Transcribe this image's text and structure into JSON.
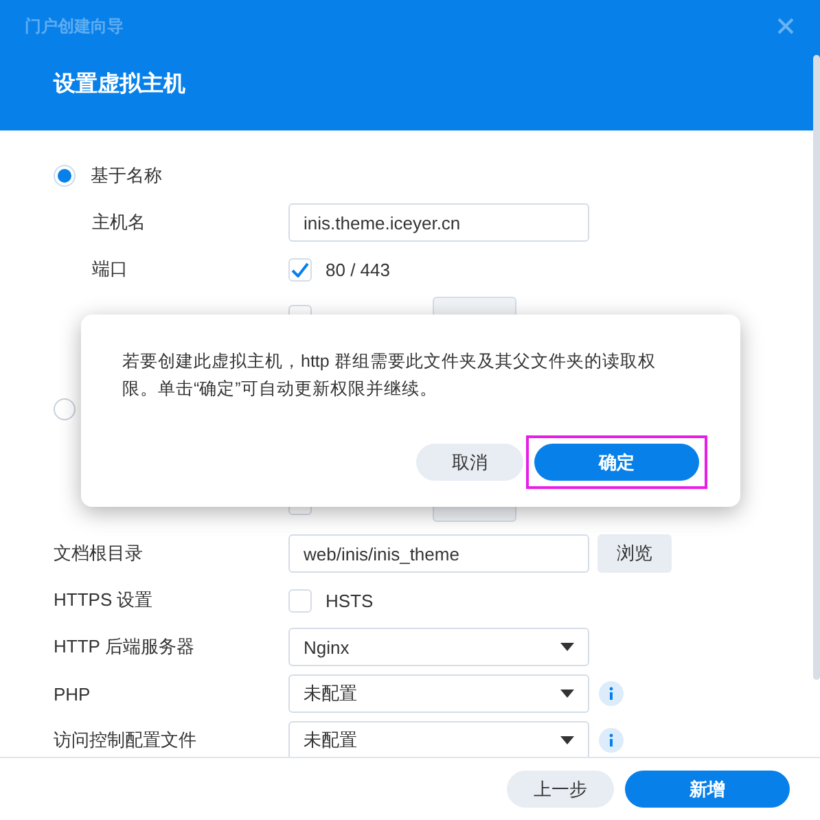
{
  "window": {
    "title": "门户创建向导",
    "subtitle": "设置虚拟主机"
  },
  "name_based": {
    "label": "基于名称",
    "selected": true
  },
  "hostname": {
    "label": "主机名",
    "value": "inis.theme.iceyer.cn"
  },
  "port": {
    "label": "端口",
    "checked": true,
    "value": "80 / 443"
  },
  "port_based": {
    "selected": false
  },
  "hidden_checks": [
    {
      "checked": false
    },
    {
      "checked": false
    }
  ],
  "document_root": {
    "label": "文档根目录",
    "value": "web/inis/inis_theme",
    "button": "浏览"
  },
  "https": {
    "label": "HTTPS 设置",
    "option": "HSTS",
    "checked": false
  },
  "selects": [
    {
      "label": "HTTP 后端服务器",
      "value": "Nginx",
      "info": false
    },
    {
      "label": "PHP",
      "value": "未配置",
      "info": true
    },
    {
      "label": "访问控制配置文件",
      "value": "未配置",
      "info": true
    }
  ],
  "footer": {
    "buttons": [
      {
        "label": "上一步",
        "kind": "secondary"
      },
      {
        "label": "新增",
        "kind": "primary"
      }
    ]
  },
  "dialog": {
    "message": "若要创建此虚拟主机，http 群组需要此文件夹及其父文件夹的读取权限。单击“确定”可自动更新权限并继续。",
    "buttons": [
      {
        "label": "取消",
        "kind": "secondary",
        "highlighted": false
      },
      {
        "label": "确定",
        "kind": "primary",
        "highlighted": true
      }
    ]
  }
}
